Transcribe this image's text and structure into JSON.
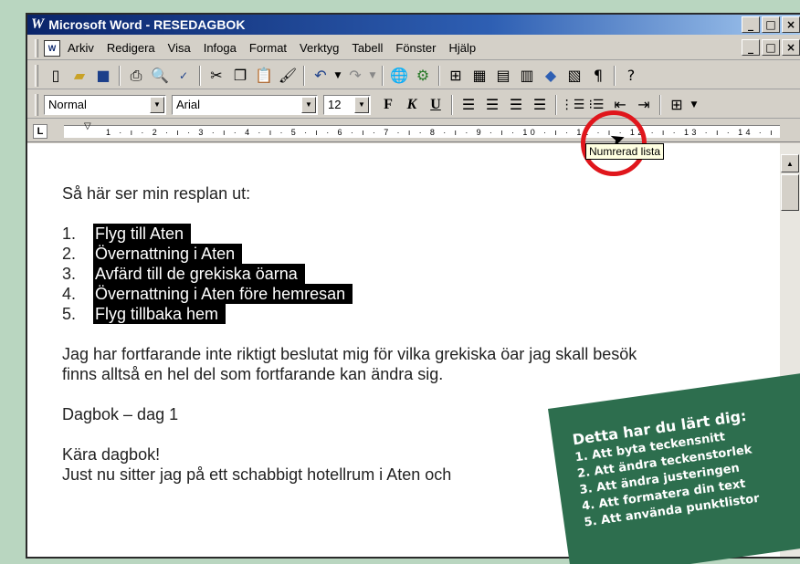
{
  "window": {
    "logo": "W",
    "title": "Microsoft Word - RESEDAGBOK"
  },
  "window_controls": [
    "_",
    "□",
    "×"
  ],
  "menu": {
    "items": [
      "Arkiv",
      "Redigera",
      "Visa",
      "Infoga",
      "Format",
      "Verktyg",
      "Tabell",
      "Fönster",
      "Hjälp"
    ]
  },
  "formatting": {
    "style": "Normal",
    "font": "Arial",
    "size": "12",
    "bold": "F",
    "italic": "K",
    "underline": "U"
  },
  "ruler_text": "1 · ı · 2 · ı · 3 · ı · 4 · ı · 5 · ı · 6 · ı · 7 · ı · 8 · ı · 9 · ı · 10 · ı · 11 · ı · 12 · ı · 13 · ı · 14 · ı",
  "tooltip": "Numrerad lista",
  "document": {
    "intro": "Så här ser min resplan ut:",
    "list": [
      {
        "num": "1.",
        "text": "Flyg till Aten"
      },
      {
        "num": "2.",
        "text": "Övernattning i Aten"
      },
      {
        "num": "3.",
        "text": "Avfärd till de grekiska öarna"
      },
      {
        "num": "4.",
        "text": "Övernattning i Aten före hemresan"
      },
      {
        "num": "5.",
        "text": "Flyg tillbaka hem"
      }
    ],
    "para1_line1": "Jag har fortfarande inte riktigt beslutat mig för vilka grekiska öar jag skall besök",
    "para1_line2": "finns alltså en hel del som fortfarande kan ändra sig.",
    "heading": "Dagbok – dag 1",
    "salutation": "Kära dagbok!",
    "body_line": "Just nu sitter jag på ett schabbigt hotellrum i Aten och"
  },
  "learned": {
    "title": "Detta har du lärt dig:",
    "items": [
      "1. Att byta teckensnitt",
      "2. Att ändra teckenstorlek",
      "3. Att ändra justeringen",
      "4. Att formatera din text",
      "5. Att använda punktlistor"
    ]
  }
}
